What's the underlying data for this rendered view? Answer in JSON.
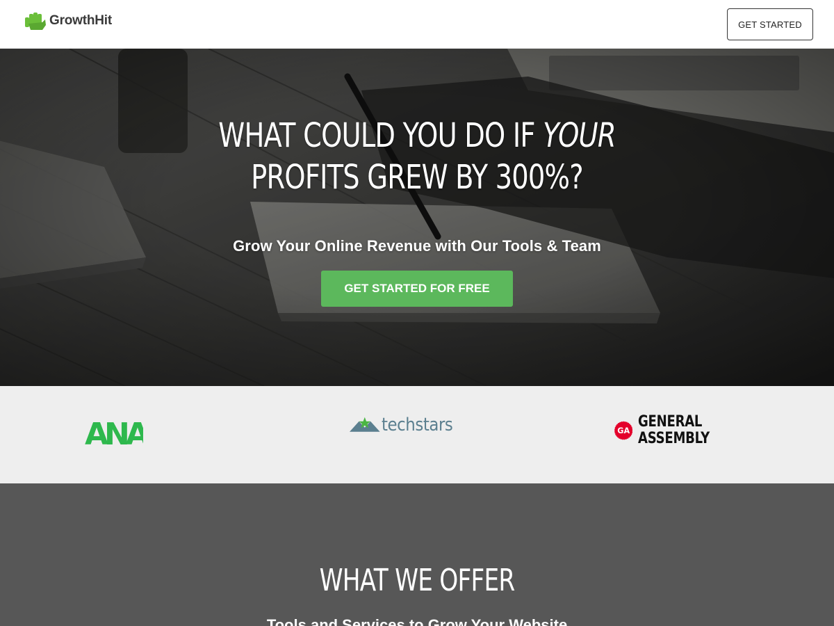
{
  "header": {
    "logo_text": "GrowthHit",
    "logo_icon": "fist-icon",
    "cta_label": "GET STARTED"
  },
  "hero": {
    "title_line1_a": "WHAT COULD YOU DO IF ",
    "title_line1_em": "YOUR",
    "title_line2": "PROFITS GREW BY 300%?",
    "subtitle": "Grow Your Online Revenue with Our Tools & Team",
    "cta_label": "GET STARTED FOR FREE"
  },
  "partners": {
    "ana": "ANA",
    "techstars": "techstars",
    "ga_badge": "GA",
    "ga_line1": "GENERAL",
    "ga_line2": "ASSEMBLY"
  },
  "offer": {
    "title": "WHAT WE OFFER",
    "subtitle": "Tools and Services to Grow Your Website"
  },
  "colors": {
    "brand_green": "#5cb85c",
    "logo_green": "#6bbf3a",
    "ana_green": "#2eb84d",
    "techstars_blue": "#5b7f8f",
    "ga_red": "#e4002b",
    "partner_bg": "#eeeeee",
    "offer_bg": "#575757"
  }
}
